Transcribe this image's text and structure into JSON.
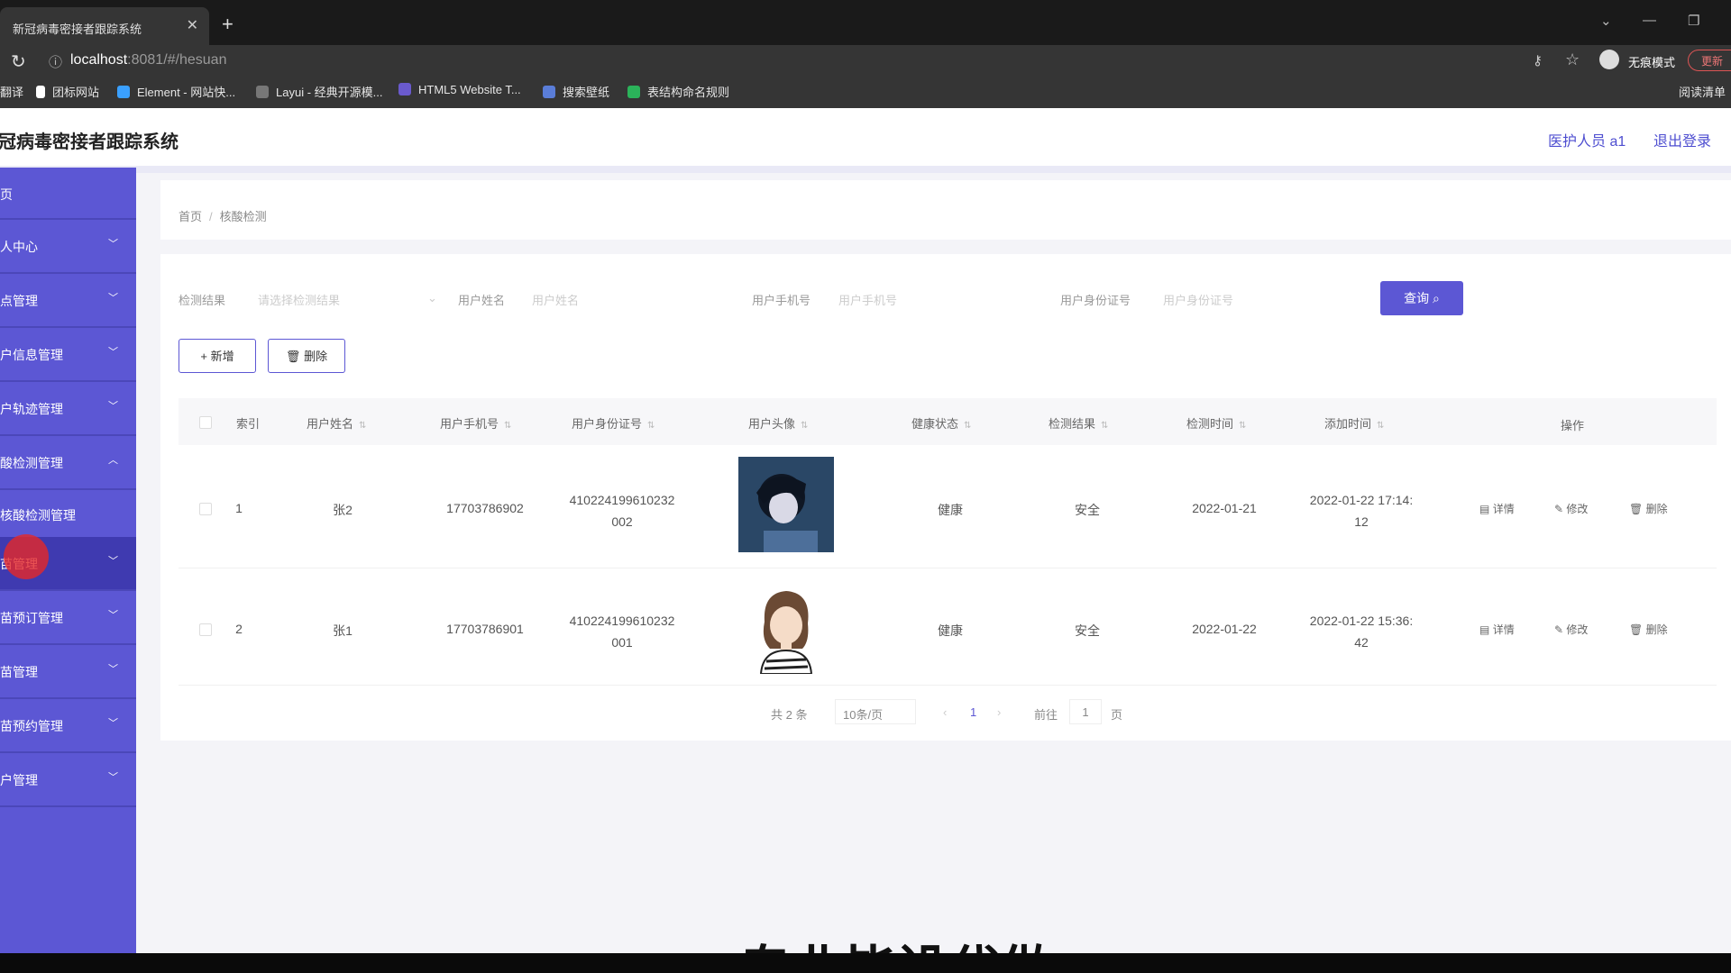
{
  "browser": {
    "tab_title": "新冠病毒密接者跟踪系统",
    "tab_close": "✕",
    "new_tab": "+",
    "url_host": "localhost",
    "url_path": ":8081/#/hesuan",
    "guest_label": "无痕模式",
    "update_label": "更新",
    "bookmarks": [
      "翻译",
      "团标网站",
      "Element - 网站快...",
      "Layui - 经典开源模...",
      "HTML5 Website T...",
      "搜索壁纸",
      "表结构命名规则"
    ],
    "reading_list": "阅读清单"
  },
  "header": {
    "app_title": "新冠病毒密接者跟踪系统",
    "user_label": "医护人员 a1",
    "logout": "退出登录"
  },
  "sidebar": {
    "items": [
      {
        "label": "首页"
      },
      {
        "label": "个人中心"
      },
      {
        "label": "地点管理"
      },
      {
        "label": "用户信息管理"
      },
      {
        "label": "用户轨迹管理"
      },
      {
        "label": "核酸检测管理"
      },
      {
        "label": "核酸检测管理"
      },
      {
        "label": "疫苗管理"
      },
      {
        "label": "疫苗预订管理"
      },
      {
        "label": "疫苗管理"
      },
      {
        "label": "疫苗预约管理"
      },
      {
        "label": "用户管理"
      }
    ]
  },
  "breadcrumb": {
    "home": "首页",
    "current": "核酸检测"
  },
  "search": {
    "f1_label": "检测结果",
    "f1_ph": "请选择检测结果",
    "f2_label": "用户姓名",
    "f2_ph": "用户姓名",
    "f3_label": "用户手机号",
    "f3_ph": "用户手机号",
    "f4_label": "用户身份证号",
    "f4_ph": "用户身份证号",
    "query": "查询"
  },
  "actions": {
    "add": "+ 新增",
    "delete": "删除"
  },
  "table": {
    "headers": [
      "索引",
      "用户姓名",
      "用户手机号",
      "用户身份证号",
      "用户头像",
      "健康状态",
      "检测结果",
      "检测时间",
      "添加时间",
      "操作"
    ],
    "rows": [
      {
        "idx": "1",
        "name": "张2",
        "phone": "17703786902",
        "id1": "410224199610232",
        "id2": "002",
        "health": "健康",
        "result": "安全",
        "test_date": "2022-01-21",
        "add1": "2022-01-22 17:14:",
        "add2": "12"
      },
      {
        "idx": "2",
        "name": "张1",
        "phone": "17703786901",
        "id1": "410224199610232",
        "id2": "001",
        "health": "健康",
        "result": "安全",
        "test_date": "2022-01-22",
        "add1": "2022-01-22 15:36:",
        "add2": "42"
      }
    ],
    "ops": {
      "detail": "详情",
      "edit": "修改",
      "delete": "删除"
    }
  },
  "pager": {
    "total": "共 2 条",
    "size": "10条/页",
    "page": "1",
    "goto": "前往",
    "goto_val": "1",
    "unit": "页"
  },
  "overlay_text": "专业毕设代做",
  "colors": {
    "primary": "#5c57d4",
    "sidebar": "#5c57d4"
  }
}
